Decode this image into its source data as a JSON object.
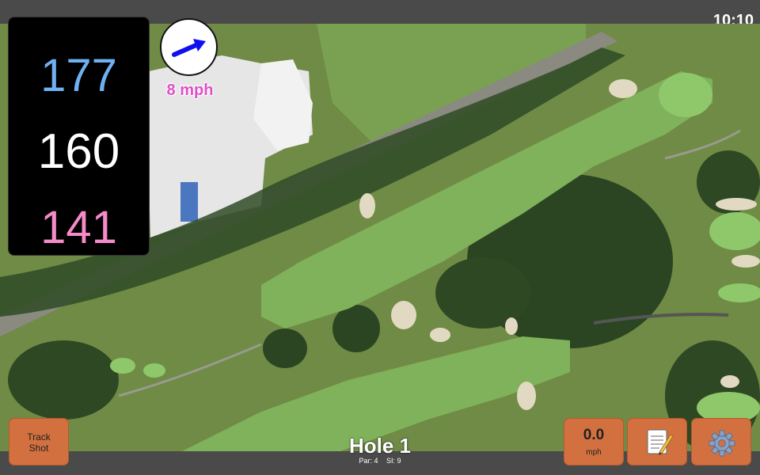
{
  "status": {
    "time": "10:10"
  },
  "distances": {
    "back": "177",
    "middle": "160",
    "front": "141"
  },
  "wind": {
    "speed": "8 mph",
    "direction_icon": "wind-arrow-icon"
  },
  "buttons": {
    "track_shot": "Track\nShot",
    "speed_value": "0.0",
    "speed_unit": "mph",
    "notes_icon": "notepad-icon",
    "settings_icon": "gear-icon"
  },
  "hole": {
    "title": "Hole 1",
    "par": "Par: 4",
    "si": "SI: 9"
  },
  "colors": {
    "accent": "#d2713f",
    "back": "#6fb0f0",
    "front": "#f58ac8",
    "wind": "#e04fc8"
  }
}
